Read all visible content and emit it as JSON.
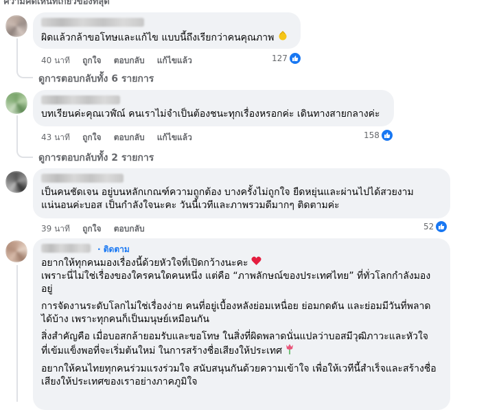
{
  "top_cut_text": "ความคิดเห็นที่เกี่ยวข้องที่สุด",
  "labels": {
    "like": "ถูกใจ",
    "reply": "ตอบกลับ",
    "edited": "แก้ไขแล้ว",
    "follow": "ติดตาม"
  },
  "comments": [
    {
      "text": "ผิดแล้วกล้าขอโทษและแก้ไข แบบนี้ถึงเรียกว่าคนคุณภาพ",
      "time": "40 นาที",
      "reactions": "127",
      "replies": "ดูการตอบกลับทั้ง 6 รายการ",
      "emoji": "clapping-hands-emoji"
    },
    {
      "text": "บทเรียนค่ะคุณเวฬ์ณ์ คนเราไม่จำเป็นต้องชนะทุกเรื่องหรอกค่ะ เดินทางสายกลางค่ะ",
      "time": "43 นาที",
      "reactions": "158",
      "replies": "ดูการตอบกลับทั้ง 2 รายการ"
    },
    {
      "line1": "เป็นคนชัดเจน อยู่บนหลักเกณฑ์ความถูกต้อง บางครั้งไม่ถูกใจ ยืดหยุ่นและผ่านไปได้สวยงาม",
      "line2": "แน่นอนค่ะบอส เป็นกำลังใจนะคะ วันนี้เวทีและภาพรวมดีมากๆ ติดตามค่ะ",
      "time": "39 นาที",
      "reactions": "52"
    },
    {
      "p1a": "อยากให้ทุกคนมองเรื่องนี้ด้วยหัวใจที่เปิดกว้างนะคะ",
      "p1b": "เพราะนี่ไม่ใช่เรื่องของใครคนใดคนหนึ่ง แต่คือ “ภาพลักษณ์ของประเทศไทย” ที่ทั่วโลกกำลังมอง",
      "p1c": "อยู่",
      "p2a": "การจัดงานระดับโลกไม่ใช่เรื่องง่าย คนที่อยู่เบื้องหลังย่อมเหนื่อย ย่อมกดดัน และย่อมมีวันที่พลาด",
      "p2b": "ได้บ้าง เพราะทุกคนก็เป็นมนุษย์เหมือนกัน",
      "p3a": "สิ่งสำคัญคือ เมื่อบอสกล้ายอมรับและขอโทษ ในสิ่งที่ผิดพลาดนั่นแปลว่าบอสมีวุฒิภาวะและหัวใจ",
      "p3b": "ที่เข้มแข็งพอที่จะเริ่มต้นใหม่ ในการสร้างชื่อเสียงให้ประเทศ",
      "p4a": "อยากให้คนไทยทุกคนร่วมแรงร่วมใจ สนับสนุนกันด้วยความเข้าใจ เพื่อให้เวทีนี้สำเร็จและสร้างชื่อ",
      "p4b": "เสียงให้ประเทศของเราอย่างภาคภูมิใจ",
      "heart_color": "#e41e3f",
      "flower_color": "#e9567b"
    }
  ],
  "colors": {
    "bubble": "#f0f2f5",
    "muted": "#65676b",
    "like_blue": "#1877f2"
  }
}
